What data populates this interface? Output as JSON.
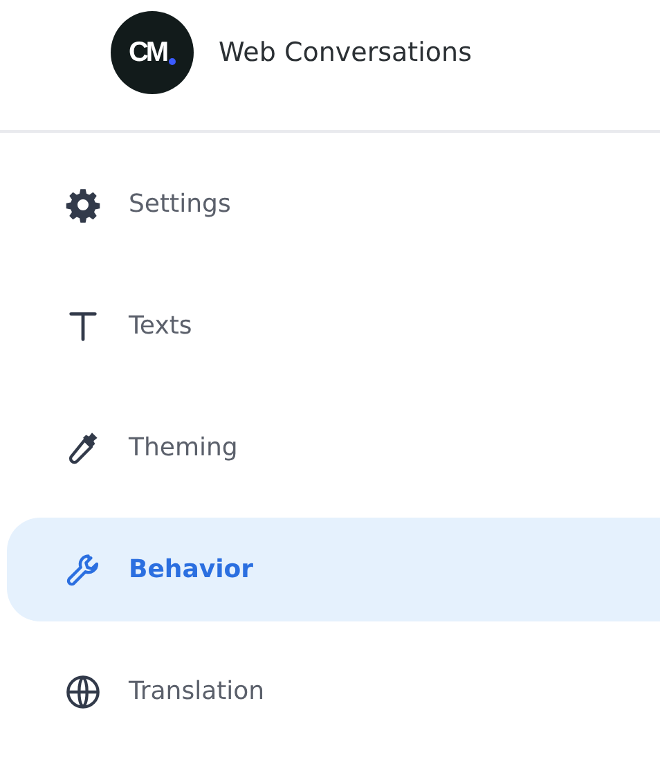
{
  "header": {
    "logo_text": "CM",
    "title": "Web Conversations"
  },
  "menu": [
    {
      "kind": "gear",
      "label": "Settings",
      "selected": false
    },
    {
      "kind": "letter",
      "label": "Texts",
      "selected": false
    },
    {
      "kind": "dropper",
      "label": "Theming",
      "selected": false
    },
    {
      "kind": "wrench",
      "label": "Behavior",
      "selected": true
    },
    {
      "kind": "globe",
      "label": "Translation",
      "selected": false
    }
  ]
}
